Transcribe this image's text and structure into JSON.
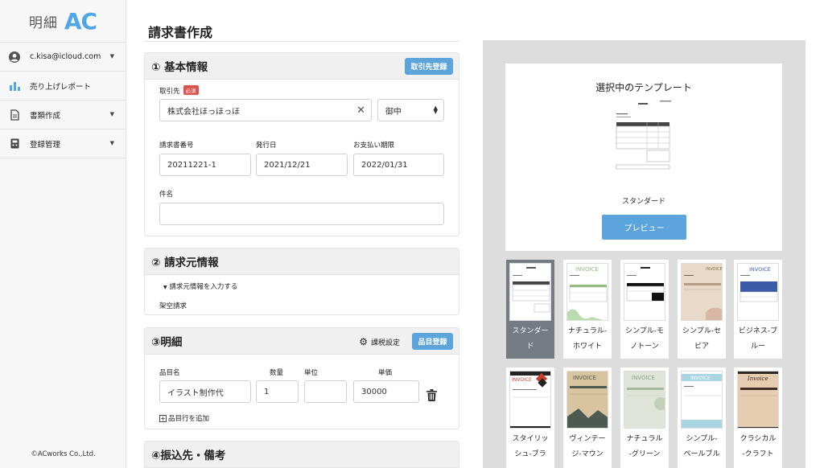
{
  "sidebar": {
    "logo_text": "明細",
    "logo_mark": "AC",
    "items": [
      {
        "label": "c.kisa@icloud.com",
        "icon": "user-icon",
        "has_caret": true
      },
      {
        "label": "売り上げレポート",
        "icon": "bar-chart-icon",
        "has_caret": false
      },
      {
        "label": "書類作成",
        "icon": "document-icon",
        "has_caret": true
      },
      {
        "label": "登録管理",
        "icon": "register-icon",
        "has_caret": true
      }
    ],
    "copyright": "©ACworks Co.,Ltd."
  },
  "main": {
    "title": "請求書作成",
    "basic": {
      "heading": "① 基本情報",
      "register_button": "取引先登録",
      "client_label": "取引先",
      "required_badge": "必須",
      "client_value": "株式会社ほっほっほ",
      "honorific": "御中",
      "invoice_no_label": "請求書番号",
      "invoice_no_value": "20211221-1",
      "issue_date_label": "発行日",
      "issue_date_value": "2021/12/21",
      "due_label": "お支払い期限",
      "due_value": "2022/01/31",
      "subject_label": "件名",
      "subject_value": ""
    },
    "issuer": {
      "heading": "② 請求元情報",
      "toggle_label": "請求元情報を入力する",
      "issuer_name": "架空請求"
    },
    "details": {
      "heading": "③明細",
      "tax_settings": "課税設定",
      "item_register_button": "品目登録",
      "columns": {
        "item": "品目名",
        "qty": "数量",
        "unit": "単位",
        "price": "単価"
      },
      "row": {
        "item": "イラスト制作代",
        "qty": "1",
        "unit": "",
        "price": "30000"
      },
      "add_row": "品目行を追加"
    },
    "bank": {
      "heading": "④振込先・備考"
    }
  },
  "templates": {
    "panel_title": "選択中のテンプレート",
    "selected_name": "スタンダード",
    "preview_button": "プレビュー",
    "row1": [
      {
        "line1": "スタンダー",
        "line2": "ド",
        "selected": true
      },
      {
        "line1": "ナチュラル-",
        "line2": "ホワイト",
        "selected": false
      },
      {
        "line1": "シンプル-モ",
        "line2": "ノトーン",
        "selected": false
      },
      {
        "line1": "シンプル-セ",
        "line2": "ピア",
        "selected": false
      },
      {
        "line1": "ビジネス-ブ",
        "line2": "ルー",
        "selected": false
      }
    ],
    "row2": [
      {
        "line1": "スタイリッ",
        "line2": "シュ-ブラ"
      },
      {
        "line1": "ヴィンテー",
        "line2": "ジ-マウン"
      },
      {
        "line1": "ナチュラル",
        "line2": "-グリーン"
      },
      {
        "line1": "シンプル-",
        "line2": "ペールブル"
      },
      {
        "line1": "クラシカル",
        "line2": "-クラフト"
      }
    ],
    "thumb_labels": [
      "INVOICE",
      "INVOICE",
      "INVOICE",
      "Invoice"
    ]
  },
  "colors": {
    "accent": "#5ba4dc",
    "required": "#d9534f",
    "selected_thumb": "#757b82"
  }
}
